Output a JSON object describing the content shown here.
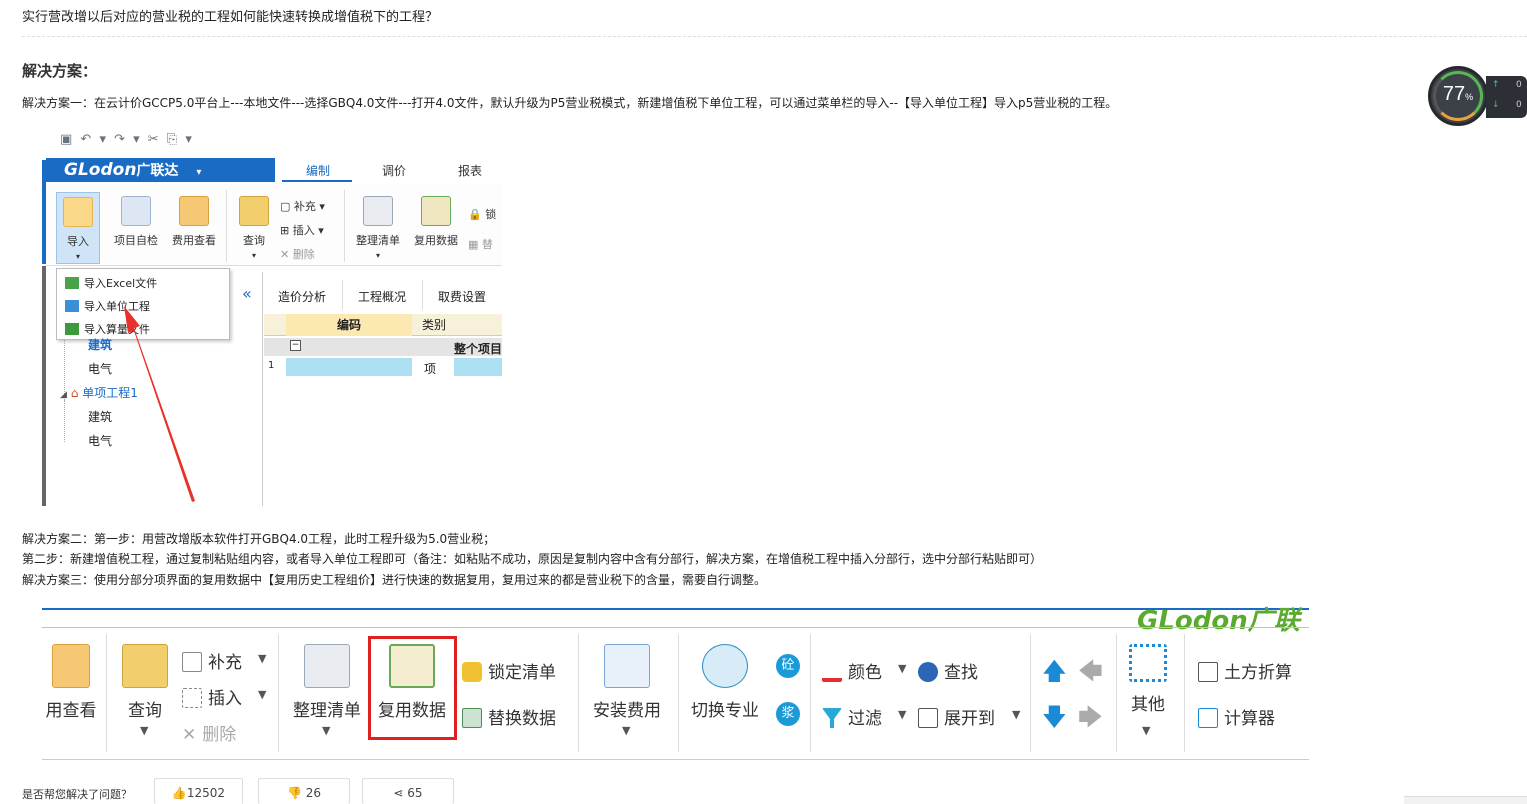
{
  "question": "实行营改增以后对应的营业税的工程如何能快速转换成增值税下的工程？",
  "solution_heading": "解决方案：",
  "solution_1": "解决方案一：在云计价GCCP5.0平台上---本地文件---选择GBQ4.0文件---打开4.0文件，默认升级为P5营业税模式，新建增值税下单位工程，可以通过菜单栏的导入--【导入单位工程】导入p5营业税的工程。",
  "solution_2_step1": "解决方案二：第一步：用营改增版本软件打开GBQ4.0工程，此时工程升级为5.0营业税；",
  "solution_2_step2": "第二步：新建增值税工程，通过复制粘贴组内容，或者导入单位工程即可（备注：如粘贴不成功，原因是复制内容中含有分部行，解决方案，在增值税工程中插入分部行，选中分部行粘贴即可）",
  "solution_3": "解决方案三：使用分部分项界面的复用数据中【复用历史工程组价】进行快速的数据复用，复用过来的都是营业税下的含量，需要自行调整。",
  "widget": {
    "percent": "77",
    "unit": "%",
    "up": "0",
    "down": "0"
  },
  "shot1": {
    "quick_access": "▣ ↶ ▾ ↷ ▾ ✂ ⎘ ▾",
    "brand": "GLodon",
    "brand_cn": "广联达",
    "brand_caret": "▾",
    "tabs": [
      "编制",
      "调价",
      "报表"
    ],
    "ribbon": {
      "import": "导入",
      "self_check": "项目自检",
      "fee_view": "费用查看",
      "query": "查询",
      "supplement": "补充",
      "insert": "插入",
      "delete": "删除",
      "organize": "整理清单",
      "reuse": "复用数据",
      "lock": "锁",
      "replace": "替"
    },
    "menu": [
      "导入Excel文件",
      "导入单位工程",
      "导入算量文件"
    ],
    "tree": [
      "建筑",
      "电气",
      "单项工程1",
      "建筑",
      "电气"
    ],
    "subtabs": [
      "造价分析",
      "工程概况",
      "取费设置"
    ],
    "grid": {
      "col_code": "编码",
      "col_type": "类别",
      "row_whole": "整个项目",
      "row_num": "1",
      "row_type": "项"
    }
  },
  "shot2": {
    "brand": "GLodon广联",
    "fee_view": "用查看",
    "query": "查询",
    "supplement": "补充",
    "insert": "插入",
    "delete": "删除",
    "organize": "整理清单",
    "reuse": "复用数据",
    "lock_list": "锁定清单",
    "replace_data": "替换数据",
    "install_fee": "安装费用",
    "switch_major": "切换专业",
    "concrete": "砼",
    "mortar": "浆",
    "color": "颜色",
    "find": "查找",
    "filter": "过滤",
    "expand_to": "展开到",
    "other": "其他",
    "earthwork": "土方折算",
    "calculator": "计算器"
  },
  "footer": {
    "question": "是否帮您解决了问题？",
    "like": "12502",
    "dislike": "26",
    "share": "65"
  }
}
